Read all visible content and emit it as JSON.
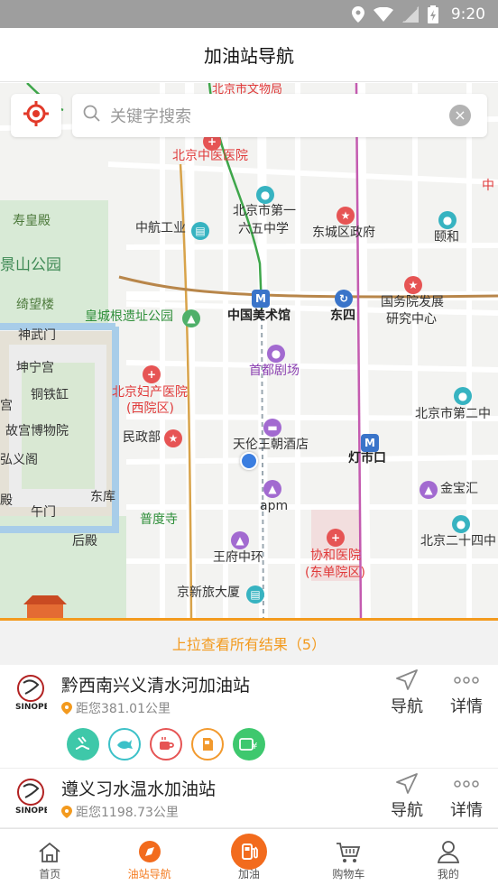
{
  "status_bar": {
    "time": "9:20"
  },
  "header": {
    "title": "加油站导航"
  },
  "search": {
    "placeholder": "关键字搜索"
  },
  "map": {
    "pois": [
      {
        "key": "zhongyi",
        "label": "北京中医医院",
        "kind": "red"
      },
      {
        "key": "shouhuang",
        "label": "寿皇殿",
        "kind": "plain"
      },
      {
        "key": "jingshan",
        "label": "景山公园",
        "kind": "park"
      },
      {
        "key": "qiwang",
        "label": "绮望楼",
        "kind": "plain"
      },
      {
        "key": "zhonghang",
        "label": "中航工业",
        "kind": "plain"
      },
      {
        "key": "b165a",
        "label": "北京市第一",
        "kind": "plain"
      },
      {
        "key": "b165b",
        "label": "六五中学",
        "kind": "plain"
      },
      {
        "key": "dongcheng",
        "label": "东城区政府",
        "kind": "plain"
      },
      {
        "key": "yihe",
        "label": "颐和",
        "kind": "plain"
      },
      {
        "key": "guowuyuan1",
        "label": "国务院发展",
        "kind": "plain"
      },
      {
        "key": "guowuyuan2",
        "label": "研究中心",
        "kind": "plain"
      },
      {
        "key": "huangcheng",
        "label": "皇城根遗址公园",
        "kind": "green"
      },
      {
        "key": "meishuguan",
        "label": "中国美术馆",
        "kind": "dark"
      },
      {
        "key": "dongsi",
        "label": "东四",
        "kind": "dark"
      },
      {
        "key": "shenwu",
        "label": "神武门",
        "kind": "plain"
      },
      {
        "key": "kunning",
        "label": "坤宁宫",
        "kind": "plain"
      },
      {
        "key": "tiedie",
        "label": "铜铁缸",
        "kind": "plain"
      },
      {
        "key": "gugong",
        "label": "故宫博物院",
        "kind": "plain"
      },
      {
        "key": "hongyi",
        "label": "弘义阁",
        "kind": "plain"
      },
      {
        "key": "gong",
        "label": "宫",
        "kind": "plain"
      },
      {
        "key": "dian",
        "label": "殿",
        "kind": "plain"
      },
      {
        "key": "wumen",
        "label": "午门",
        "kind": "plain"
      },
      {
        "key": "dongku",
        "label": "东库",
        "kind": "plain"
      },
      {
        "key": "houdian",
        "label": "后殿",
        "kind": "plain"
      },
      {
        "key": "shoudu",
        "label": "首都剧场",
        "kind": "purple"
      },
      {
        "key": "fuchan1",
        "label": "北京妇产医院",
        "kind": "red"
      },
      {
        "key": "fuchan2",
        "label": "(西院区)",
        "kind": "red"
      },
      {
        "key": "minzheng",
        "label": "民政部",
        "kind": "plain"
      },
      {
        "key": "tianlun",
        "label": "天伦王朝酒店",
        "kind": "plain"
      },
      {
        "key": "dengshikou",
        "label": "灯市口",
        "kind": "dark"
      },
      {
        "key": "b2nd",
        "label": "北京市第二中",
        "kind": "plain"
      },
      {
        "key": "jinbao",
        "label": "金宝汇",
        "kind": "plain"
      },
      {
        "key": "apm",
        "label": "apm",
        "kind": "plain"
      },
      {
        "key": "puduo",
        "label": "普度寺",
        "kind": "green"
      },
      {
        "key": "wangfu",
        "label": "王府中环",
        "kind": "plain"
      },
      {
        "key": "xiehe1",
        "label": "协和医院",
        "kind": "red"
      },
      {
        "key": "xiehe2",
        "label": "(东单院区)",
        "kind": "red"
      },
      {
        "key": "b24",
        "label": "北京二十四中",
        "kind": "plain"
      },
      {
        "key": "jingxin",
        "label": "京新旅大厦",
        "kind": "plain"
      },
      {
        "key": "zhongyi_edge",
        "label": "中",
        "kind": "red"
      },
      {
        "key": "top_cut",
        "label": "北京市文物局",
        "kind": "red"
      }
    ]
  },
  "results_bar": {
    "label": "上拉查看所有结果（5）"
  },
  "stations": [
    {
      "name": "黔西南兴义清水河加油站",
      "distance": "距您381.01公里",
      "nav_label": "导航",
      "detail_label": "详情",
      "services": [
        "wash-icon",
        "water-icon",
        "coffee-icon",
        "fuel-icon",
        "payment-icon"
      ]
    },
    {
      "name": "遵义习水温水加油站",
      "distance": "距您1198.73公里",
      "nav_label": "导航",
      "detail_label": "详情"
    }
  ],
  "bottom_nav": {
    "items": [
      {
        "label": "首页"
      },
      {
        "label": "油站导航"
      },
      {
        "label": "加油"
      },
      {
        "label": "购物车"
      },
      {
        "label": "我的"
      }
    ],
    "active_index": 1
  },
  "colors": {
    "accent": "#f39a1e",
    "active_nav": "#f47b20",
    "fab": "#f26b1d"
  }
}
